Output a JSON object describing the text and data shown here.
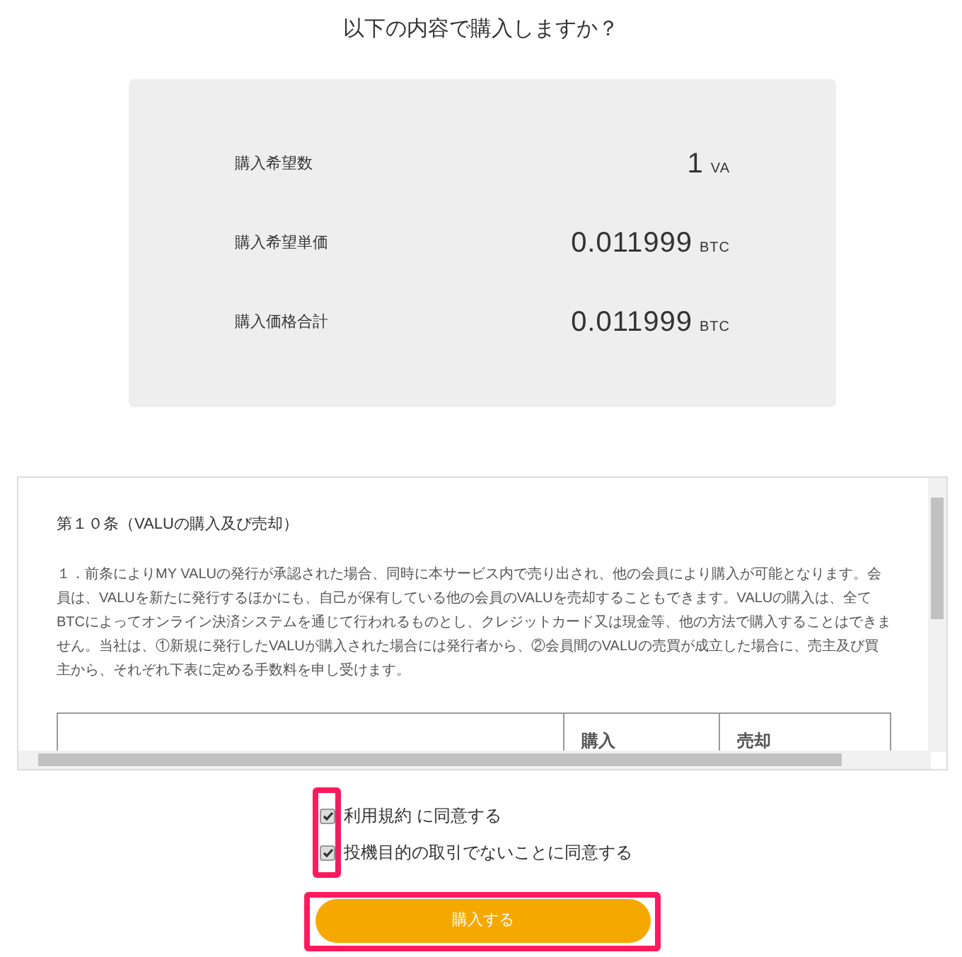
{
  "heading": "以下の内容で購入しますか？",
  "summary": [
    {
      "label": "購入希望数",
      "value": "1",
      "unit": "VA"
    },
    {
      "label": "購入希望単価",
      "value": "0.011999",
      "unit": "BTC"
    },
    {
      "label": "購入価格合計",
      "value": "0.011999",
      "unit": "BTC"
    }
  ],
  "terms": {
    "title": "第１０条（VALUの購入及び売却）",
    "paragraph": "１．前条によりMY VALUの発行が承認された場合、同時に本サービス内で売り出され、他の会員により購入が可能となります。会員は、VALUを新たに発行するほかにも、自己が保有している他の会員のVALUを売却することもできます。VALUの購入は、全てBTCによってオンライン決済システムを通じて行われるものとし、クレジットカード又は現金等、他の方法で購入することはできません。当社は、①新規に発行したVALUが購入された場合には発行者から、②会員間のVALUの売買が成立した場合に、売主及び買主から、それぞれ下表に定める手数料を申し受けます。",
    "table_columns": [
      "購入",
      "売却"
    ]
  },
  "agreements": [
    {
      "label": "利用規約 に同意する",
      "checked": true
    },
    {
      "label": "投機目的の取引でないことに同意する",
      "checked": true
    }
  ],
  "submit": "購入する"
}
